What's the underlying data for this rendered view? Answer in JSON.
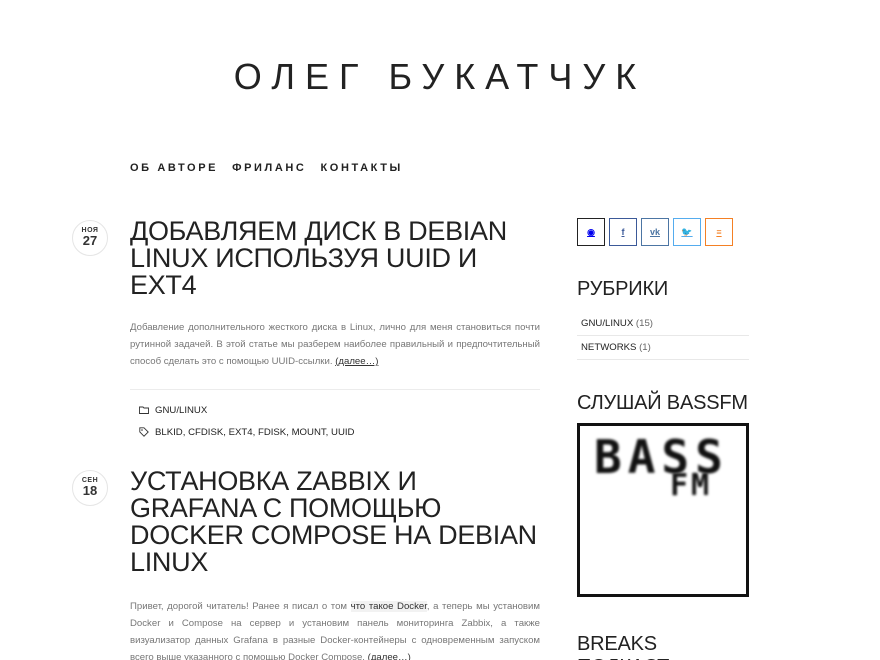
{
  "site": {
    "title": "ОЛЕГ БУКАТЧУК"
  },
  "nav": {
    "items": [
      "ОБ АВТОРЕ",
      "ФРИЛАНС",
      "КОНТАКТЫ"
    ]
  },
  "posts": [
    {
      "date": {
        "month": "НОЯ",
        "day": "27"
      },
      "title": "ДОБАВЛЯЕМ ДИСК В DEBIAN LINUX ИСПОЛЬЗУЯ UUID И EXT4",
      "excerpt": "Добавление дополнительного жесткого диска в Linux, лично для меня становиться почти рутинной задачей. В этой статье мы разберем наиболее правильный и предпочтительный способ сделать это с помощью UUID-ссылки.",
      "more": "(далее…)",
      "category": "GNU/LINUX",
      "tags": [
        "BLKID",
        "CFDISK",
        "EXT4",
        "FDISK",
        "MOUNT",
        "UUID"
      ]
    },
    {
      "date": {
        "month": "СЕН",
        "day": "18"
      },
      "title": "УСТАНОВКА ZABBIX И GRAFANA С ПОМОЩЬЮ DOCKER COMPOSE НА DEBIAN LINUX",
      "excerpt_before": "Привет, дорогой читатель! Ранее я писал о том",
      "excerpt_link": "что такое Docker",
      "excerpt_after": ", а теперь мы установим Docker и Compose на сервер и установим панель мониторинга Zabbix, а также визуализатор данных Grafana в разные Docker-контейнеры с одновременным запуском всего выше указанного с помощью Docker Compose.",
      "more": "(далее…)"
    }
  ],
  "sidebar": {
    "socials": [
      {
        "icon": "github-icon",
        "glyph": "◉",
        "color": "#222222"
      },
      {
        "icon": "facebook-icon",
        "glyph": "f",
        "color": "#3b5998"
      },
      {
        "icon": "vk-icon",
        "glyph": "vk",
        "color": "#4c75a3"
      },
      {
        "icon": "twitter-icon",
        "glyph": "🐦",
        "color": "#55acee"
      },
      {
        "icon": "stackoverflow-icon",
        "glyph": "≡",
        "color": "#f48024"
      }
    ],
    "categories_title": "РУБРИКИ",
    "categories": [
      {
        "name": "GNU/LINUX",
        "count": "(15)"
      },
      {
        "name": "NETWORKS",
        "count": "(1)"
      }
    ],
    "bassfm_title": "СЛУШАЙ BASSFM",
    "bassfm_logo": {
      "top": "BASS",
      "bottom": "FM"
    },
    "podcast_title": "BREAKS ПОДКАСТ"
  }
}
